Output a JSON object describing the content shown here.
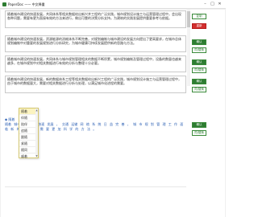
{
  "window": {
    "title": "PaperDoc —— 中文降重",
    "controls": [
      "–",
      "□",
      "✕"
    ]
  },
  "paragraphs": [
    {
      "text": "随着城市建设的快速发展，共同体系等相关数据给出新兴并工程的广泛实践，城市规划设计施工与运营管理过程中，会出现各种问题，需要有更为直接有效的方法来进行，做出可靠的决策分析支持，为建筑的实践发展提供重要参考与依据。"
    },
    {
      "text": "随着城市建设的快速发展，资源能源的消耗体系不断完善，对规划编制与城市建设的发展方向提出了更高要求，在城市总体规划编制中对重要的发展规划进行分析研究，为城市健康可持续发展提供新的思路与方法。"
    },
    {
      "text": "随着城市建设的快速发展，共同体系与城市规划管理相关的数据不断积累，城市规划编制及管理过程中，设备的数量也越来越多，在城市规划中对相关数据进行有效的分析与整理十分必要。"
    },
    {
      "text": "随着城市建设的快速发展，新的数据体系工程等相关数据给出新兴工程的广泛实践，城市规划设计施工与运营管理过程中，由于城市的数据量大，需要对相关数据进行分析与处理，以满足城市化进程的需要。"
    }
  ],
  "side_buttons": {
    "copy": "复制",
    "reset": "重新",
    "confirm": "确认",
    "replace": "同/替换"
  },
  "popup_menu": {
    "items": [
      "随着",
      "伴随",
      "陪伴",
      "追随",
      "跟随",
      "紧随",
      "随同",
      "顺着"
    ],
    "selected_index": 0
  },
  "link_row": {
    "marker": "◆ 随着",
    "words": [
      "随着",
      "城市",
      "建设",
      "的",
      "快速",
      "发展",
      "，",
      "交通",
      "运输",
      "网",
      "络",
      "系",
      "统",
      "日",
      "益",
      "完",
      "善",
      "，",
      "城",
      "市",
      "规",
      "划",
      "管",
      "理",
      "工",
      "作",
      "面",
      "临",
      "新",
      "的",
      "挑",
      "战",
      "，",
      "需",
      "要",
      "更",
      "加",
      "科",
      "学",
      "的",
      "方",
      "法",
      "。"
    ]
  }
}
